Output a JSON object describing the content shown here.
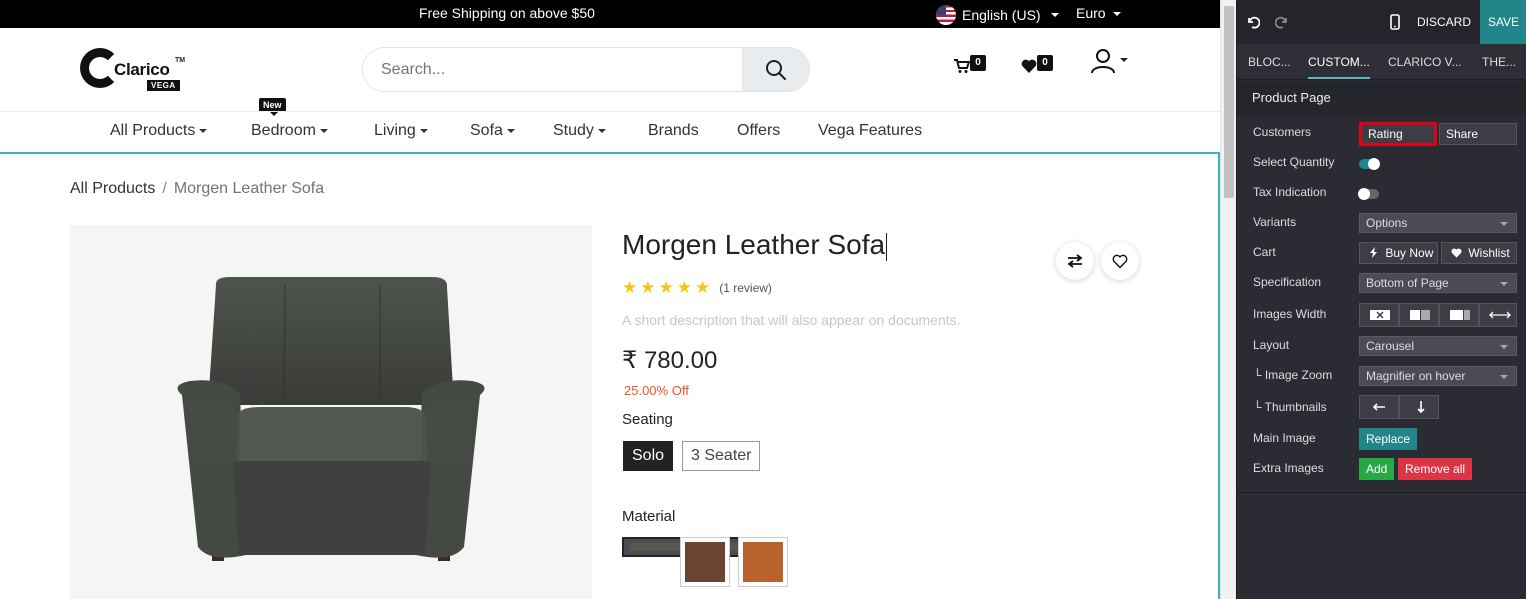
{
  "topbar": {
    "shipping": "Free Shipping on above $50",
    "language": "English (US)",
    "currency": "Euro"
  },
  "header": {
    "logo": {
      "word": "Clarico",
      "tm": "TM",
      "sub": "VEGA"
    },
    "search_placeholder": "Search...",
    "cart_count": "0",
    "wishlist_count": "0"
  },
  "nav": {
    "new_tag": "New",
    "items": [
      "All Products",
      "Bedroom",
      "Living",
      "Sofa",
      "Study",
      "Brands",
      "Offers",
      "Vega Features"
    ]
  },
  "breadcrumb": {
    "root": "All Products",
    "sep": "/",
    "current": "Morgen Leather Sofa"
  },
  "product": {
    "title": "Morgen Leather Sofa",
    "rating": 5,
    "stars": [
      "★",
      "★",
      "★",
      "★",
      "★"
    ],
    "reviews": "(1 review)",
    "description": "A short description that will also appear on documents.",
    "price": "₹ 780.00",
    "discount": "25.00% Off",
    "seating_label": "Seating",
    "seating_options": [
      "Solo",
      "3 Seater"
    ],
    "material_label": "Material",
    "material_colors": [
      "#55584f",
      "#6c4230",
      "#b9622e"
    ]
  },
  "editor": {
    "discard": "DISCARD",
    "save": "SAVE",
    "tabs": [
      "BLOC...",
      "CUSTOM...",
      "CLARICO V...",
      "THE..."
    ],
    "section": "Product Page",
    "rows": {
      "customers": {
        "label": "Customers",
        "opt1": "Rating",
        "opt2": "Share"
      },
      "select_quantity": {
        "label": "Select Quantity",
        "on": true
      },
      "tax_indication": {
        "label": "Tax Indication",
        "on": false
      },
      "variants": {
        "label": "Variants",
        "value": "Options"
      },
      "cart": {
        "label": "Cart",
        "opt1": "Buy Now",
        "opt2": "Wishlist"
      },
      "specification": {
        "label": "Specification",
        "value": "Bottom of Page"
      },
      "images_width": {
        "label": "Images Width"
      },
      "layout": {
        "label": "Layout",
        "value": "Carousel"
      },
      "image_zoom": {
        "label": "└ Image Zoom",
        "value": "Magnifier on hover"
      },
      "thumbnails": {
        "label": "└ Thumbnails"
      },
      "main_image": {
        "label": "Main Image",
        "button": "Replace"
      },
      "extra_images": {
        "label": "Extra Images",
        "add": "Add",
        "remove": "Remove all"
      }
    },
    "colors": {
      "accent": "#21858a",
      "highlight": "#e3001b",
      "add": "#28a745",
      "remove": "#dc3545",
      "replace": "#21858a"
    }
  }
}
